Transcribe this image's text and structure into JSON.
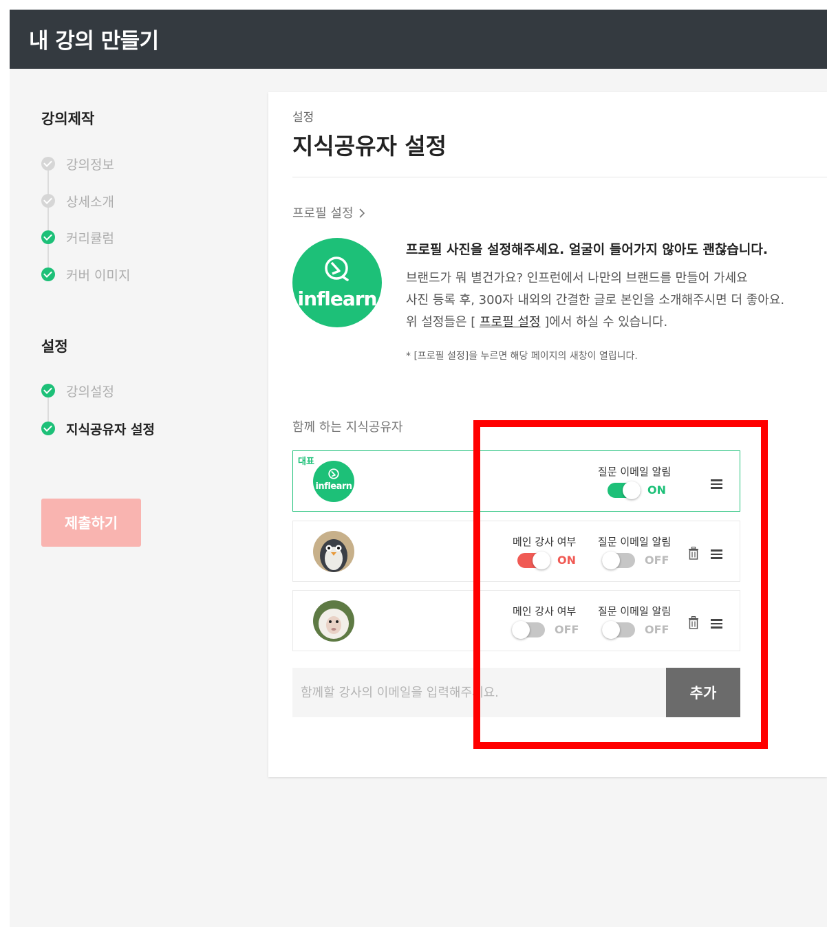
{
  "header": {
    "title": "내 강의 만들기"
  },
  "sidebar": {
    "section_create": "강의제작",
    "create_steps": [
      {
        "label": "강의정보",
        "done": false
      },
      {
        "label": "상세소개",
        "done": false
      },
      {
        "label": "커리큘럼",
        "done": true
      },
      {
        "label": "커버 이미지",
        "done": true
      }
    ],
    "section_settings": "설정",
    "settings_steps": [
      {
        "label": "강의설정",
        "done": true
      },
      {
        "label": "지식공유자 설정",
        "done": true,
        "active": true
      }
    ],
    "submit_label": "제출하기"
  },
  "main": {
    "breadcrumb": "설정",
    "title": "지식공유자 설정",
    "profile": {
      "link_label": "프로필 설정",
      "logo_text": "inflearn",
      "headline": "프로필 사진을 설정해주세요. 얼굴이 들어가지 않아도 괜찮습니다.",
      "line1": "브랜드가 뭐 별건가요? 인프런에서 나만의 브랜드를 만들어 가세요",
      "line2": "사진 등록 후, 300자 내외의 간결한 글로 본인을 소개해주시면 더 좋아요.",
      "line3_prefix": "위 설정들은 [ ",
      "line3_link": "프로필 설정",
      "line3_suffix": " ]에서 하실 수 있습니다.",
      "note": "* [프로필 설정]을 누르면 해당 페이지의 새창이 열립니다."
    },
    "collab_section_label": "함께 하는 지식공유자",
    "toggle_labels": {
      "main_instructor": "메인 강사 여부",
      "question_email": "질문 이메일 알림"
    },
    "states": {
      "on": "ON",
      "off": "OFF"
    },
    "instructors": [
      {
        "badge": "대표",
        "avatar_text": "inflearn",
        "question_email": true
      },
      {
        "avatar": "penguin",
        "main_instructor": true,
        "question_email": false
      },
      {
        "avatar": "sheep",
        "main_instructor": false,
        "question_email": false
      }
    ],
    "add": {
      "placeholder": "함께할 강사의 이메일을 입력해주세요.",
      "button_label": "추가"
    }
  },
  "colors": {
    "brand_green": "#1dc078",
    "toggle_red": "#f05a54",
    "highlight_red": "#ff0000",
    "header_bg": "#343a40"
  }
}
